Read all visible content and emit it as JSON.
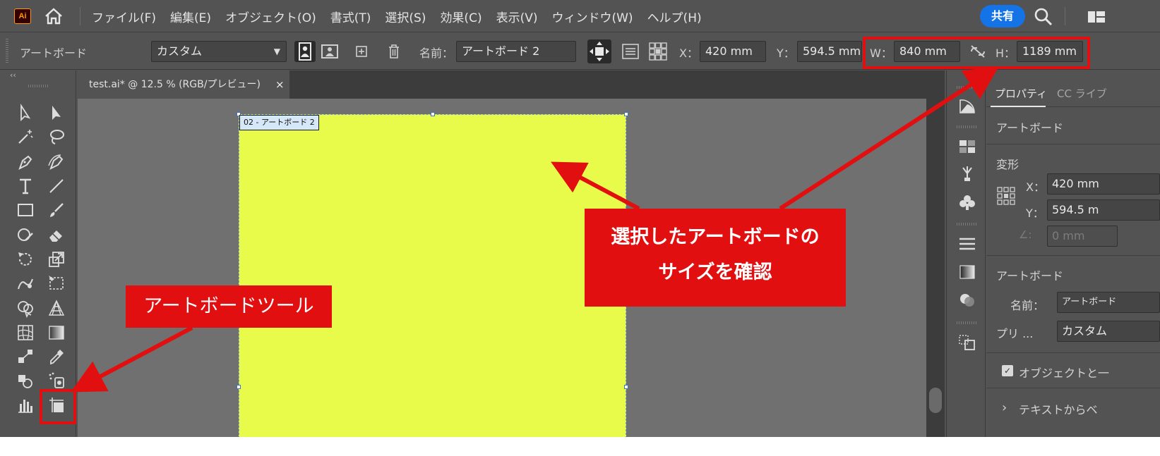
{
  "menubar": {
    "logo": "Ai",
    "items": [
      "ファイル(F)",
      "編集(E)",
      "オブジェクト(O)",
      "書式(T)",
      "選択(S)",
      "効果(C)",
      "表示(V)",
      "ウィンドウ(W)",
      "ヘルプ(H)"
    ],
    "share_label": "共有",
    "icons": [
      "home-icon",
      "search-icon",
      "workspace-layout-icon"
    ]
  },
  "controlbar": {
    "title": "アートボード",
    "preset": "カスタム",
    "name_label": "名前：",
    "name_value": "アートボード 2",
    "x_label": "X：",
    "x_value": "420 mm",
    "y_label": "Y：",
    "y_value": "594.5 mm",
    "w_label": "W：",
    "w_value": "840 mm",
    "h_label": "H：",
    "h_value": "1189 mm",
    "icons": [
      "portrait-icon",
      "landscape-icon",
      "new-artboard-icon",
      "delete-artboard-icon",
      "move-with-artboard-icon",
      "artboard-options-icon",
      "reference-point-icon",
      "constrain-proportions-icon"
    ]
  },
  "document": {
    "tab_title": "test.ai* @ 12.5 % (RGB/プレビュー)",
    "close": "×",
    "artboard_label": "02 - アートボード 2",
    "artboard_color": "#e8fb4a"
  },
  "toolbar": {
    "collapse": "‹‹",
    "tools": [
      "selection-tool",
      "direct-selection-tool",
      "magic-wand-tool",
      "lasso-tool",
      "pen-tool",
      "curvature-tool",
      "type-tool",
      "line-segment-tool",
      "rectangle-tool",
      "paintbrush-tool",
      "shaper-tool",
      "eraser-tool",
      "rotate-tool",
      "scale-tool",
      "warp-tool",
      "free-transform-tool",
      "shape-builder-tool",
      "perspective-grid-tool",
      "mesh-tool",
      "gradient-tool",
      "blend-tool",
      "eyedropper-tool",
      "symbol-sprayer-tool",
      "live-paint-tool",
      "graph-tool",
      "artboard-tool"
    ]
  },
  "icon_strip": {
    "icons": [
      "color-guide-icon",
      "swatches-icon",
      "brushes-icon",
      "symbols-icon",
      "stroke-icon",
      "gradient-icon",
      "transparency-icon",
      "artboards-icon"
    ]
  },
  "properties": {
    "tab_active": "プロパティ",
    "tab_inactive": "CC ライブ",
    "section_title": "アートボード",
    "transform_title": "変形",
    "x_label": "X：",
    "x_value": "420 mm",
    "y_label": "Y：",
    "y_value": "594.5 m",
    "angle_value": "0 mm",
    "artboard_title": "アートボード",
    "name_label": "名前：",
    "name_value": "アートボード",
    "preset_label": "プリ ...",
    "preset_value": "カスタム",
    "checkbox_label": "オブジェクトと一",
    "checkbox_mark": "✓",
    "more_label": "テキストからベ",
    "more_chevron": "›"
  },
  "annotations": {
    "callout_main_line1": "選択したアートボードの",
    "callout_main_line2": "サイズを確認",
    "callout_tool": "アートボードツール",
    "color": "#e10f10"
  }
}
